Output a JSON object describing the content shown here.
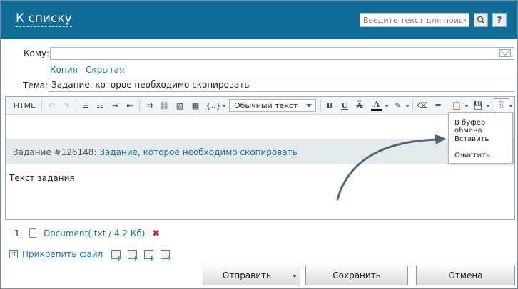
{
  "header": {
    "back_label": "К списку",
    "search_placeholder": "Введите текст для поиска",
    "help_label": "?"
  },
  "form": {
    "to_label": "Кому:",
    "to_value": "",
    "cc_link": "Копия",
    "bcc_link": "Скрытая",
    "subject_label": "Тема:",
    "subject_value": "Задание, которое необходимо скопировать"
  },
  "toolbar": {
    "html_label": "HTML",
    "format_value": "Обычный текст",
    "bold": "B",
    "underline": "U",
    "strike": "Ӓ",
    "font_color": "A"
  },
  "editor": {
    "task_prefix": "Задание #126148:",
    "task_link": "Задание, которое необходимо скопировать",
    "body_text": "Текст задания"
  },
  "clipboard_menu": {
    "items": [
      "В буфер обмена",
      "Вставить",
      "Очистить"
    ]
  },
  "attachments": {
    "index": "1.",
    "file_name": "Document",
    "file_meta": "(.txt / 4.2 Кб)",
    "add_file_link": "Прикрепить файл"
  },
  "buttons": {
    "send": "Отправить",
    "save": "Сохранить",
    "cancel": "Отмена"
  },
  "colors": {
    "header_bg": "#0f6d98",
    "link": "#1d6ea8",
    "arrow": "#4f6676",
    "delete": "#c62828"
  }
}
